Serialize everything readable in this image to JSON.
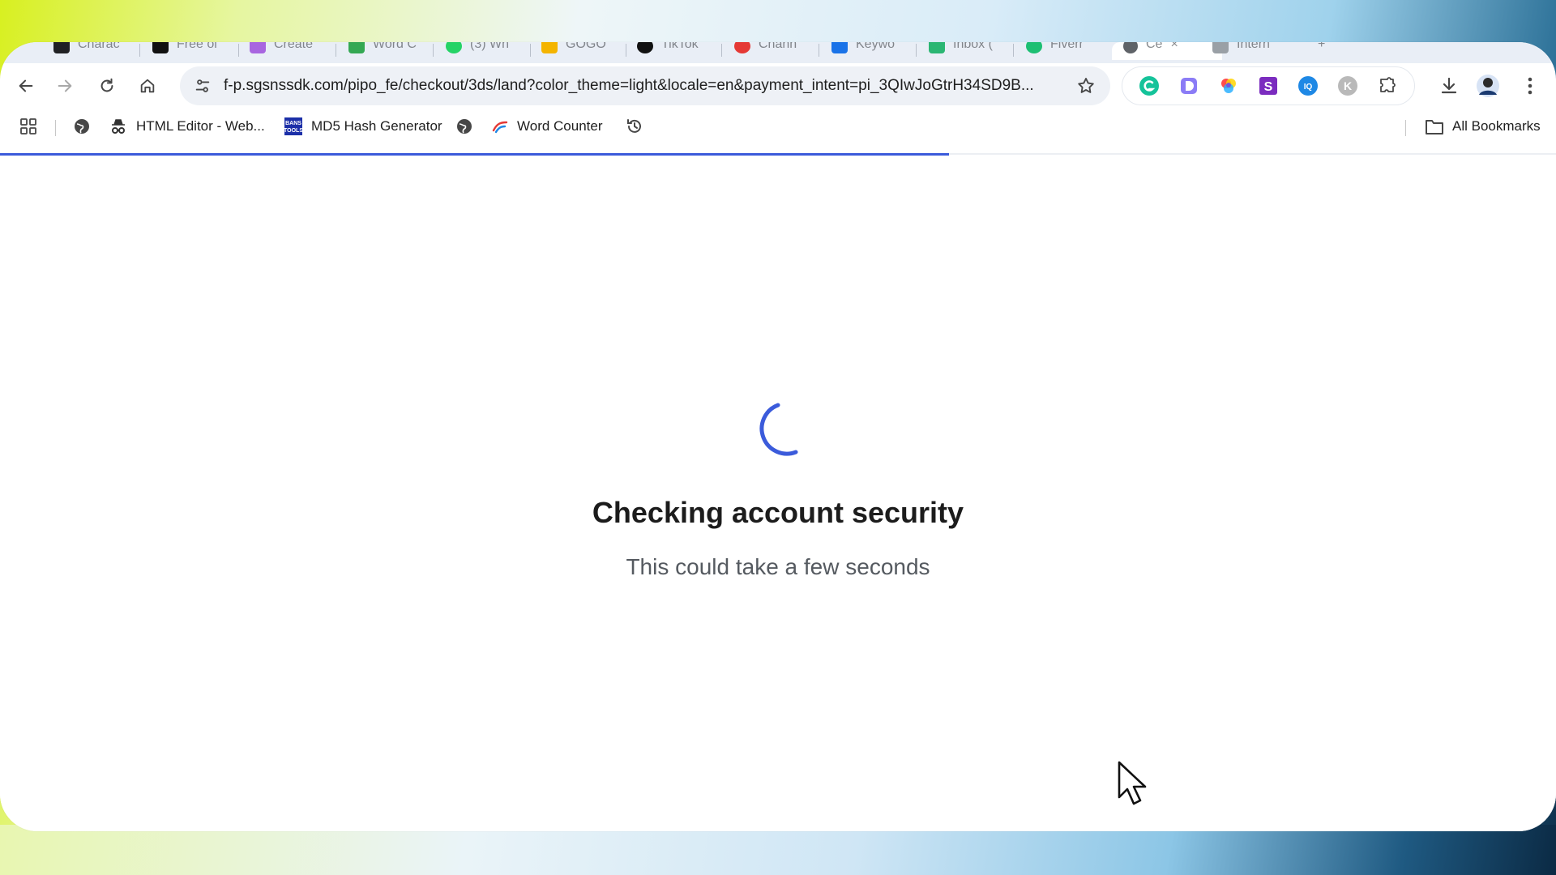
{
  "tabs": [
    {
      "label": "Charac",
      "color": "#202124"
    },
    {
      "label": "Free ol",
      "color": "#111111"
    },
    {
      "label": "Create",
      "color": "#a865e0"
    },
    {
      "label": "Word C",
      "color": "#34a853"
    },
    {
      "label": "(3) Wh",
      "color": "#25d366"
    },
    {
      "label": "GOGO",
      "color": "#f4b400"
    },
    {
      "label": "TikTok",
      "color": "#111111"
    },
    {
      "label": "Chann",
      "color": "#e53935"
    },
    {
      "label": "Keywo",
      "color": "#1a73e8"
    },
    {
      "label": "Inbox (",
      "color": "#2bb673"
    },
    {
      "label": "Fiverr",
      "color": "#1dbf73"
    },
    {
      "label": "Ce",
      "color": "#5f6368"
    },
    {
      "label": "Intern",
      "color": "#9aa0a6"
    }
  ],
  "address_bar": {
    "url": "f-p.sgsnssdk.com/pipo_fe/checkout/3ds/land?color_theme=light&locale=en&payment_intent=pi_3QIwJoGtrH34SD9B..."
  },
  "bookmarks": {
    "items": [
      {
        "label": "HTML Editor - Web..."
      },
      {
        "label": "MD5 Hash Generator"
      },
      {
        "label": "Word Counter"
      }
    ],
    "all_bookmarks": "All Bookmarks"
  },
  "page": {
    "heading": "Checking account security",
    "subtext": "This could take a few seconds",
    "load_progress": 0.61
  },
  "colors": {
    "accent": "#3b5bdb",
    "heading": "#1c1c1c",
    "subtext": "#555a60"
  }
}
